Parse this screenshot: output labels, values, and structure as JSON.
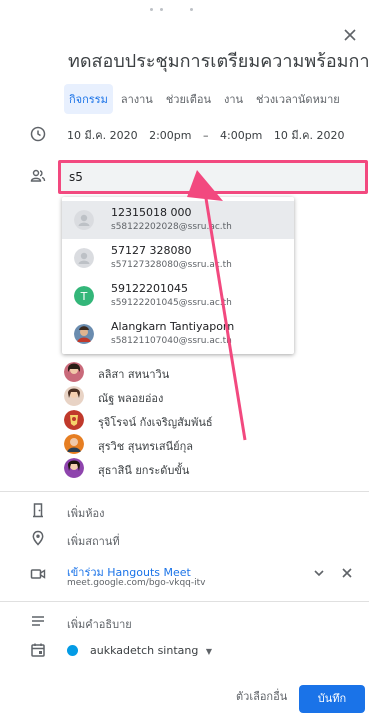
{
  "event": {
    "title": "ทดสอบประชุมการเตรียมความพร้อมการจัด",
    "tabs": [
      "กิจกรรม",
      "ลางาน",
      "ช่วยเตือน",
      "งาน",
      "ช่วงเวลานัดหมาย"
    ],
    "date_start": "10 มี.ค. 2020",
    "time_start": "2:00pm",
    "dash": "–",
    "time_end": "4:00pm",
    "date_end": "10 มี.ค. 2020"
  },
  "guest_input": {
    "value": "s5"
  },
  "suggestions": [
    {
      "name": "12315018 000",
      "email": "s58122202028@ssru.ac.th",
      "avatar": "person-placeholder",
      "highlighted": true
    },
    {
      "name": "57127 328080",
      "email": "s57127328080@ssru.ac.th",
      "avatar": "person-placeholder"
    },
    {
      "name": "59122201045",
      "email": "s59122201045@ssru.ac.th",
      "avatar": "letter",
      "letter": "T"
    },
    {
      "name": "Alangkarn Tantiyaporn",
      "email": "s58121107040@ssru.ac.th",
      "avatar": "photo"
    }
  ],
  "guests": [
    "ลลิสา สหนาวิน",
    "ณัฐ พลอยอ่อง",
    "รุจิโรจน์ กังเจริญสัมพันธ์",
    "สุรวิช สุนทรเสนีย์กุล",
    "สุธาสินี ยกระดับขั้น"
  ],
  "room": {
    "label": "เพิ่มห้อง"
  },
  "location": {
    "label": "เพิ่มสถานที่"
  },
  "meet": {
    "join": "เข้าร่วม Hangouts Meet",
    "url": "meet.google.com/bgo-vkqq-itv"
  },
  "description": {
    "label": "เพิ่มคำอธิบาย"
  },
  "calendar": {
    "owner": "aukkadetch sintang"
  },
  "footer": {
    "more_options": "ตัวเลือกอื่น",
    "save": "บันทึก"
  },
  "colors": {
    "accent": "#1a73e8",
    "highlight": "#f2497f",
    "calendar_dot": "#039be5"
  }
}
